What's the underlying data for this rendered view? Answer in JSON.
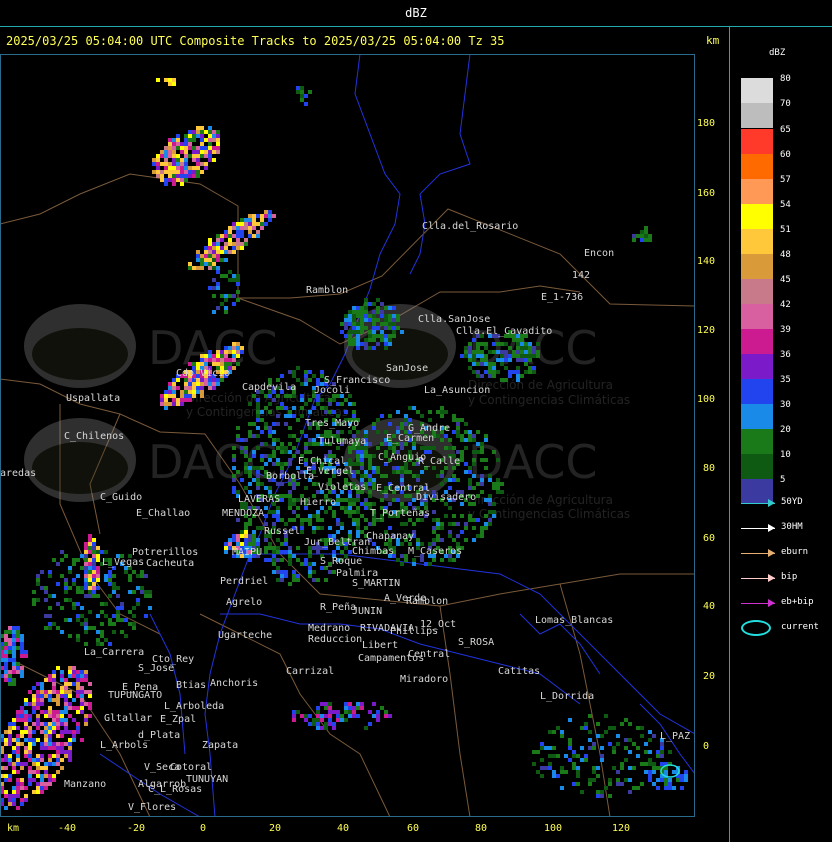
{
  "header": {
    "title": "dBZ",
    "subtitle": "2025/03/25 05:04:00 UTC Composite Tracks to 2025/03/25 05:04:00 Tz 35",
    "km_unit": "km"
  },
  "axes": {
    "x_unit": "km",
    "x_ticks": [
      "-40",
      "-20",
      "0",
      "20",
      "40",
      "60",
      "80",
      "100",
      "120"
    ],
    "y_ticks": [
      "180",
      "160",
      "140",
      "120",
      "100",
      "80",
      "60",
      "40",
      "20",
      "0"
    ]
  },
  "legend": {
    "title": "dBZ",
    "levels": [
      {
        "label": "80",
        "color": "#dcdcdc"
      },
      {
        "label": "70",
        "color": "#bdbdbd"
      },
      {
        "label": "65",
        "color": "#ff3a2a"
      },
      {
        "label": "60",
        "color": "#ff6a00"
      },
      {
        "label": "57",
        "color": "#ff9955"
      },
      {
        "label": "54",
        "color": "#ffff00"
      },
      {
        "label": "51",
        "color": "#ffc83a"
      },
      {
        "label": "48",
        "color": "#d99a3a"
      },
      {
        "label": "45",
        "color": "#c87a8a"
      },
      {
        "label": "42",
        "color": "#d860a0"
      },
      {
        "label": "39",
        "color": "#cc1a90"
      },
      {
        "label": "36",
        "color": "#7a1ac8"
      },
      {
        "label": "35",
        "color": "#2244ee"
      },
      {
        "label": "30",
        "color": "#1a8ae8"
      },
      {
        "label": "20",
        "color": "#1a7a1a"
      },
      {
        "label": "10",
        "color": "#0e5a12"
      },
      {
        "label": "5",
        "color": "#3a3aa0"
      }
    ],
    "tracks": [
      {
        "label": "50YD",
        "color": "#33cccc"
      },
      {
        "label": "30HM",
        "color": "#ffffff"
      },
      {
        "label": "eburn",
        "color": "#e8b070"
      },
      {
        "label": "bip",
        "color": "#ffcccc"
      },
      {
        "label": "eb+bip",
        "color": "#d030d0"
      }
    ],
    "current_label": "current",
    "current_color": "#22dddd"
  },
  "places": [
    {
      "name": "Clla.del_Rosario"
    },
    {
      "name": "Encon"
    },
    {
      "name": "142"
    },
    {
      "name": "E_1-736"
    },
    {
      "name": "Ramblon"
    },
    {
      "name": "Clla.SanJose"
    },
    {
      "name": "Clla.El_Cavadito"
    },
    {
      "name": "SanJose"
    },
    {
      "name": "Uspallata"
    },
    {
      "name": "Cdo_Vicio"
    },
    {
      "name": "Capdevila"
    },
    {
      "name": "S_Francisco"
    },
    {
      "name": "Jocoli"
    },
    {
      "name": "La_Asuncion"
    },
    {
      "name": "C_Chilenos"
    },
    {
      "name": "Tres_Mayo"
    },
    {
      "name": "Tulumaya"
    },
    {
      "name": "E_Carmen"
    },
    {
      "name": "G_Andre"
    },
    {
      "name": "aredas"
    },
    {
      "name": "E_Chical"
    },
    {
      "name": "E_Vergel"
    },
    {
      "name": "C_Anguio"
    },
    {
      "name": "R_Calle"
    },
    {
      "name": "Borbolla"
    },
    {
      "name": "Violetas"
    },
    {
      "name": "E_Central"
    },
    {
      "name": "Divisadero"
    },
    {
      "name": "C_Guido"
    },
    {
      "name": "LAVERAS"
    },
    {
      "name": "Hierro"
    },
    {
      "name": "E_Challao"
    },
    {
      "name": "MENDOZA"
    },
    {
      "name": "T_Porteñas"
    },
    {
      "name": "Chapanay"
    },
    {
      "name": "Jur_Beltran"
    },
    {
      "name": "Chimbas"
    },
    {
      "name": "M_Caseros"
    },
    {
      "name": "Potrerillos"
    },
    {
      "name": "Cacheuta"
    },
    {
      "name": "L_Vegas"
    },
    {
      "name": "MAIPU"
    },
    {
      "name": "Russel"
    },
    {
      "name": "Perdriel"
    },
    {
      "name": "S_Roque"
    },
    {
      "name": "Palmira"
    },
    {
      "name": "S_MARTIN"
    },
    {
      "name": "Agrelo"
    },
    {
      "name": "R_Peña"
    },
    {
      "name": "JUNIN"
    },
    {
      "name": "A_Verde"
    },
    {
      "name": "Ramblon"
    },
    {
      "name": "Lomas_Blancas"
    },
    {
      "name": "Ugarteche"
    },
    {
      "name": "Medrano"
    },
    {
      "name": "RIVADAVIA"
    },
    {
      "name": "Phillips"
    },
    {
      "name": "12_Oct"
    },
    {
      "name": "Reduccion"
    },
    {
      "name": "Libert"
    },
    {
      "name": "S_ROSA"
    },
    {
      "name": "La_Carrera"
    },
    {
      "name": "Cto_Rey"
    },
    {
      "name": "S_Jose"
    },
    {
      "name": "Carrizal"
    },
    {
      "name": "Campamentos"
    },
    {
      "name": "Central"
    },
    {
      "name": "Catitas"
    },
    {
      "name": "E_Pena"
    },
    {
      "name": "TUPUNGATO"
    },
    {
      "name": "Btias"
    },
    {
      "name": "Anchoris"
    },
    {
      "name": "Miradoro"
    },
    {
      "name": "L_Dorrida"
    },
    {
      "name": "L_Arboleda"
    },
    {
      "name": "Gltallar"
    },
    {
      "name": "E_Zpal"
    },
    {
      "name": "d_Plata"
    },
    {
      "name": "L_Arbols"
    },
    {
      "name": "Zapata"
    },
    {
      "name": "Algarrob"
    },
    {
      "name": "V_Seca"
    },
    {
      "name": "Cotoral"
    },
    {
      "name": "TUNUYAN"
    },
    {
      "name": "Manzano"
    },
    {
      "name": "C_L_Rosas"
    },
    {
      "name": "V_Flores"
    },
    {
      "name": "L_PAZ"
    }
  ],
  "watermarks": [
    {
      "brand": "DACC",
      "line1": "Dirección de Agricultura",
      "line2": "y Contingencias Climáticas"
    }
  ]
}
